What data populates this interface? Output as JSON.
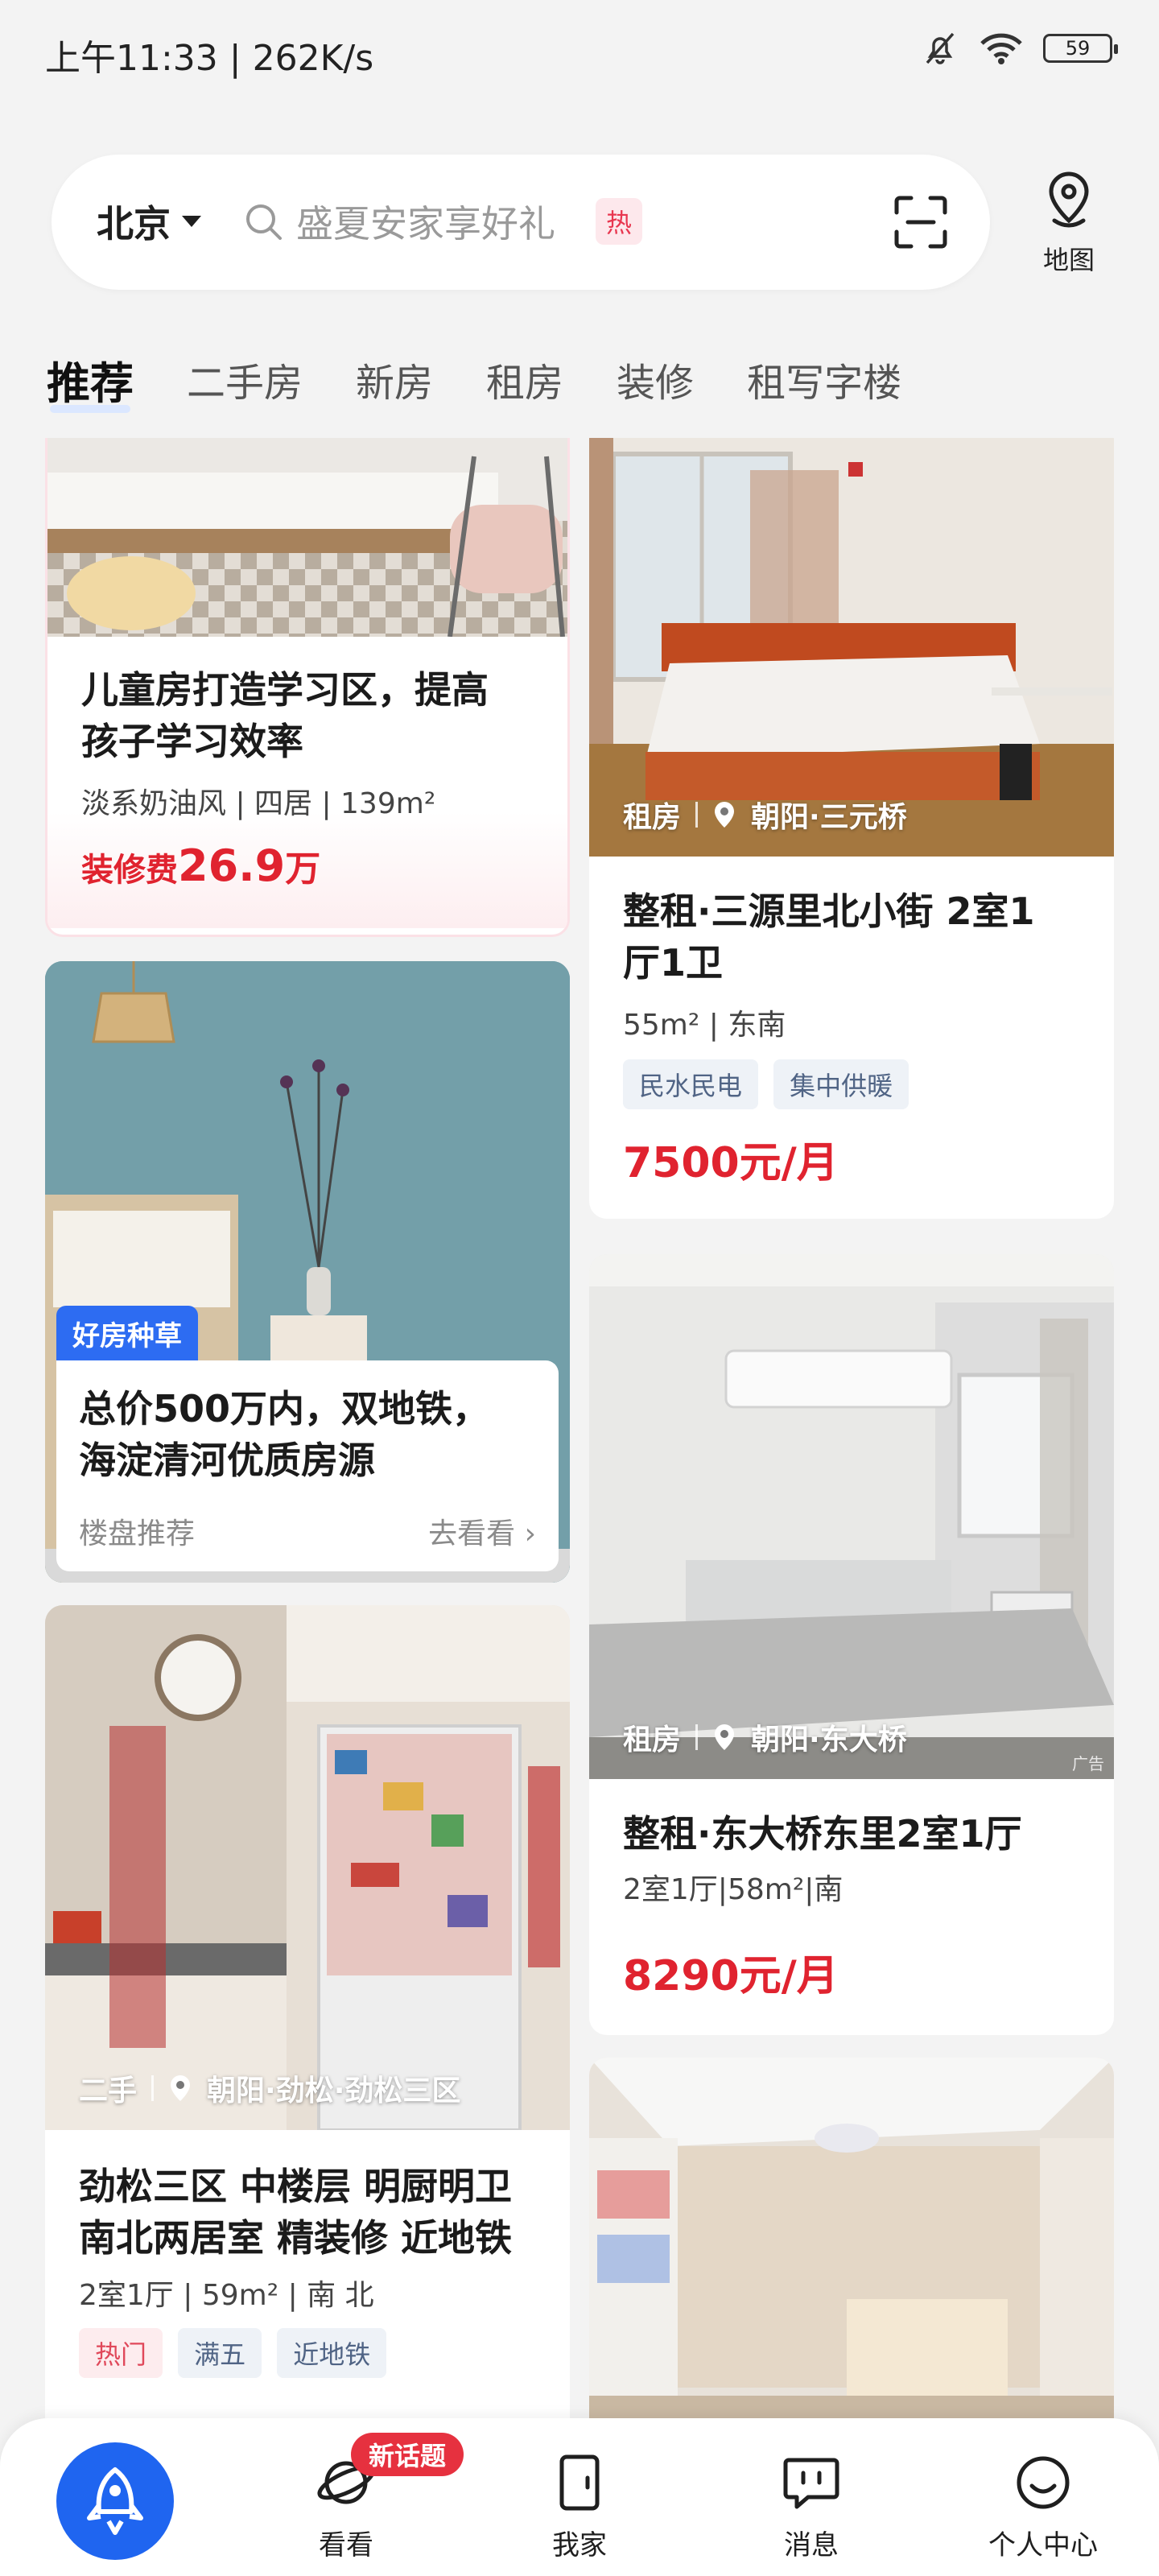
{
  "status_bar": {
    "time": "上午11:33 | 262K/s",
    "battery": "59"
  },
  "search": {
    "city": "北京",
    "placeholder": "盛夏安家享好礼",
    "hot_badge": "热",
    "map_label": "地图"
  },
  "tabs": [
    {
      "label": "推荐",
      "active": true
    },
    {
      "label": "二手房"
    },
    {
      "label": "新房"
    },
    {
      "label": "租房"
    },
    {
      "label": "装修"
    },
    {
      "label": "租写字楼"
    }
  ],
  "feed": {
    "reno_card": {
      "title_line1": "儿童房打造学习区，提高",
      "title_line2": "孩子学习效率",
      "meta": "淡系奶油风 | 四居 | 139m²",
      "price_prefix": "装修费",
      "price_value": "26.9",
      "price_unit": "万"
    },
    "rent_card_1": {
      "type": "租房",
      "location": "朝阳·三元桥",
      "title_line1": "整租·三源里北小街 2室1",
      "title_line2": "厅1卫",
      "meta": "55m² | 东南",
      "tags": [
        "民水民电",
        "集中供暖"
      ],
      "price": "7500元/月"
    },
    "recommend_card": {
      "badge": "好房种草",
      "title_line1": "总价500万内，双地铁，",
      "title_line2": "海淀清河优质房源",
      "footer_left": "楼盘推荐",
      "footer_right": "去看看"
    },
    "rent_card_2": {
      "type": "租房",
      "location": "朝阳·东大桥",
      "title": "整租·东大桥东里2室1厅",
      "meta": "2室1厅|58m²|南",
      "price": "8290元/月",
      "ad_label": "广告"
    },
    "second_card": {
      "type": "二手",
      "location": "朝阳·劲松·劲松三区",
      "title_line1": "劲松三区 中楼层 明厨明卫",
      "title_line2": "南北两居室 精装修 近地铁",
      "meta": "2室1厅 | 59m² | 南 北",
      "tags": [
        "热门",
        "满五",
        "近地铁"
      ]
    }
  },
  "bottom_nav": {
    "items": [
      {
        "label": "看看"
      },
      {
        "label": "我家"
      },
      {
        "label": "消息"
      },
      {
        "label": "个人中心"
      }
    ],
    "new_badge": "新话题"
  },
  "colors": {
    "accent_blue": "#1f65f0",
    "price_red": "#e0232f"
  }
}
